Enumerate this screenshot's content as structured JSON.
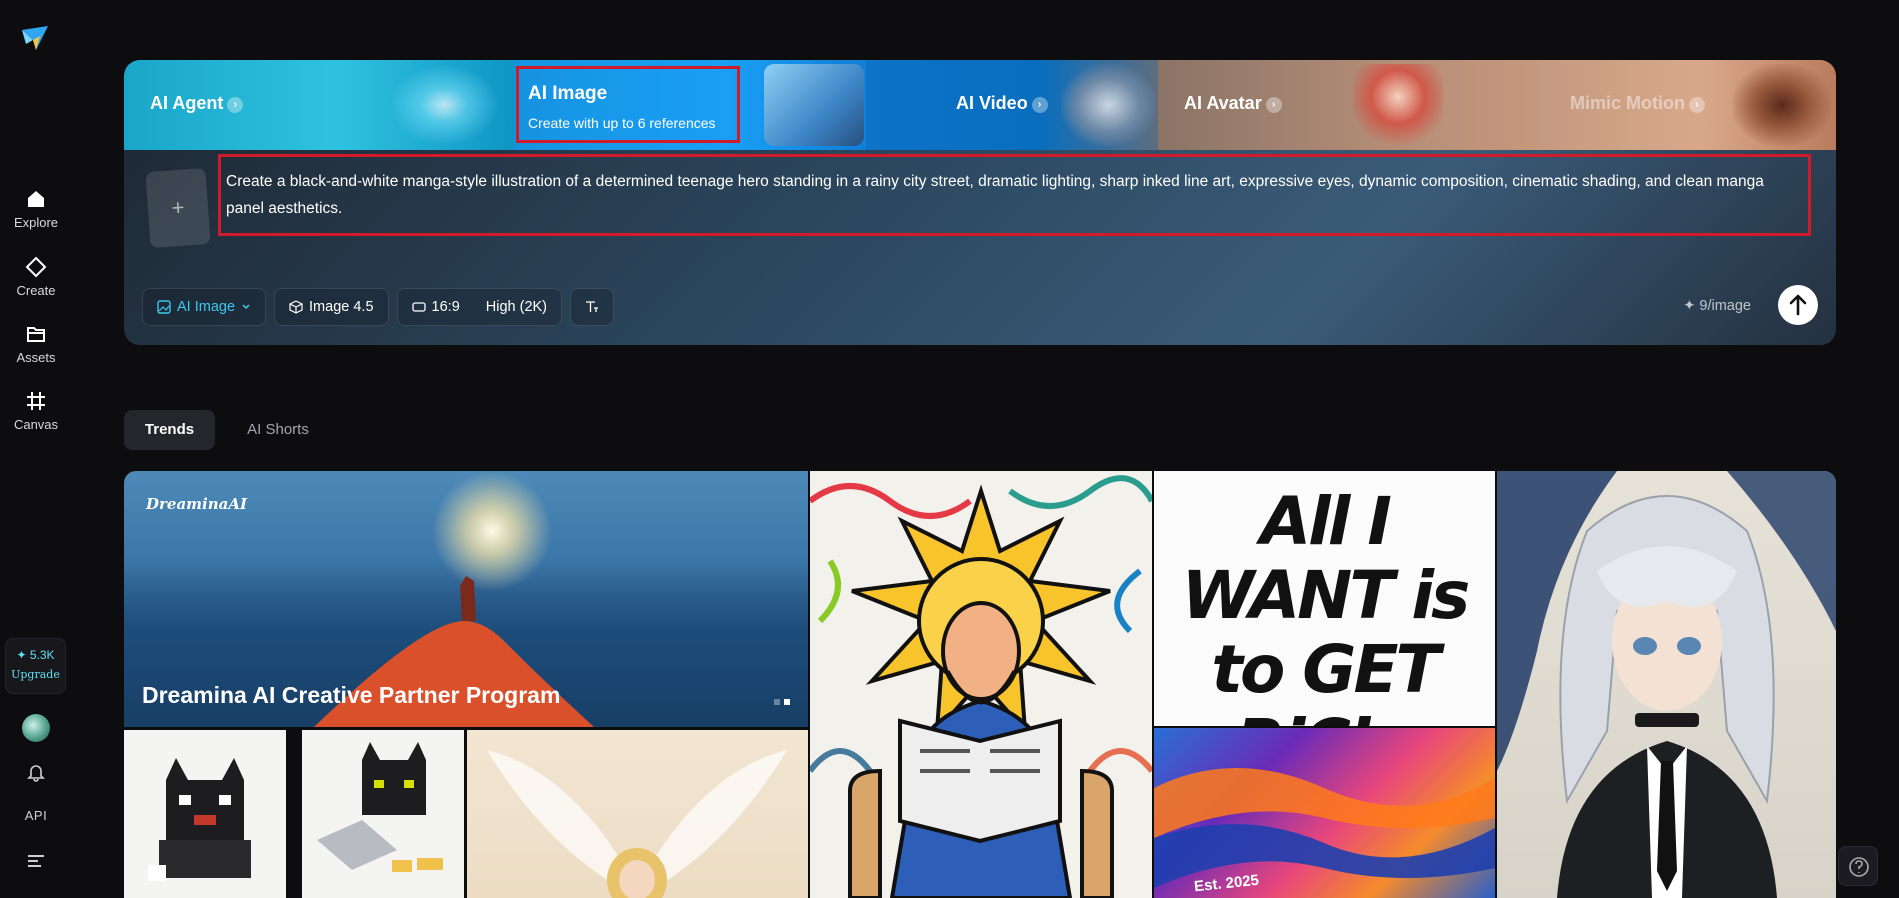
{
  "sidebar": {
    "nav": [
      {
        "label": "Explore",
        "icon": "home-icon"
      },
      {
        "label": "Create",
        "icon": "diamond-icon"
      },
      {
        "label": "Assets",
        "icon": "folder-icon"
      },
      {
        "label": "Canvas",
        "icon": "canvas-icon"
      }
    ],
    "credits": "✦ 5.3K",
    "upgrade_label": "Upgrade",
    "api_label": "API"
  },
  "hero": {
    "tabs": [
      {
        "label": "AI Agent"
      },
      {
        "label": "AI Image",
        "subtitle": "Create with up to 6 references",
        "selected": true
      },
      {
        "label": "AI Video"
      },
      {
        "label": "AI Avatar"
      },
      {
        "label": "Mimic Motion"
      }
    ],
    "prompt": "Create a black-and-white manga-style illustration of a determined teenage hero standing in a rainy city street, dramatic lighting, sharp inked line art, expressive eyes, dynamic composition, cinematic shading, and clean manga panel aesthetics.",
    "add_reference_symbol": "+",
    "controls": {
      "mode": "AI Image",
      "model": "Image 4.5",
      "ratio": "16:9",
      "quality": "High (2K)"
    },
    "cost": "✦ 9/image"
  },
  "trends": {
    "tabs": [
      "Trends",
      "AI Shorts"
    ]
  },
  "gallery": {
    "banner_brand": "DreaminaAI",
    "banner_title": "Dreamina AI Creative Partner Program",
    "rich_text": "All I WANT is to GET RiCh.",
    "est_text": "Est. 2025"
  },
  "colors": {
    "accent": "#3cc9f0",
    "highlight_border": "#d11a2a",
    "background": "#0d0d10"
  }
}
